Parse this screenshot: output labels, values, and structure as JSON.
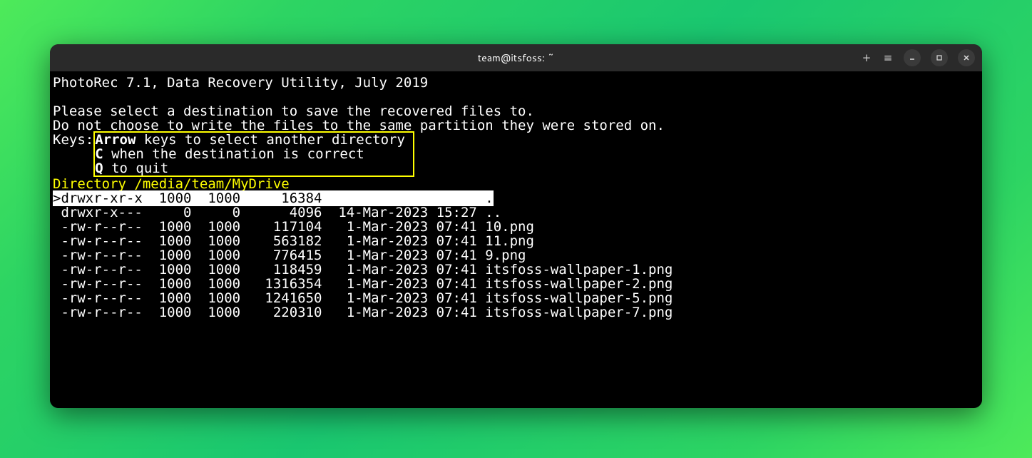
{
  "window": {
    "title": "team@itsfoss: ~"
  },
  "app": {
    "header": "PhotoRec 7.1, Data Recovery Utility, July 2019",
    "prompt1": "Please select a destination to save the recovered files to.",
    "prompt2": "Do not choose to write the files to the same partition they were stored on.",
    "keys_label": "Keys:",
    "keys": {
      "arrow_key": "Arrow",
      "arrow_desc": " keys to select another directory",
      "c_key": "C",
      "c_desc": " when the destination is correct",
      "q_key": "Q",
      "q_desc": " to quit"
    },
    "directory_label": "Directory ",
    "directory_path": "/media/team/MyDrive"
  },
  "files": [
    {
      "perm": ">drwxr-xr-x",
      "uid": " 1000",
      "gid": " 1000",
      "size": "    16384",
      "date": "                  ",
      "name": ".",
      "selected": true
    },
    {
      "perm": " drwxr-x---",
      "uid": "    0",
      "gid": "    0",
      "size": "     4096",
      "date": " 14-Mar-2023 15:27",
      "name": ".."
    },
    {
      "perm": " -rw-r--r--",
      "uid": " 1000",
      "gid": " 1000",
      "size": "   117104",
      "date": "  1-Mar-2023 07:41",
      "name": "10.png"
    },
    {
      "perm": " -rw-r--r--",
      "uid": " 1000",
      "gid": " 1000",
      "size": "   563182",
      "date": "  1-Mar-2023 07:41",
      "name": "11.png"
    },
    {
      "perm": " -rw-r--r--",
      "uid": " 1000",
      "gid": " 1000",
      "size": "   776415",
      "date": "  1-Mar-2023 07:41",
      "name": "9.png"
    },
    {
      "perm": " -rw-r--r--",
      "uid": " 1000",
      "gid": " 1000",
      "size": "   118459",
      "date": "  1-Mar-2023 07:41",
      "name": "itsfoss-wallpaper-1.png"
    },
    {
      "perm": " -rw-r--r--",
      "uid": " 1000",
      "gid": " 1000",
      "size": "  1316354",
      "date": "  1-Mar-2023 07:41",
      "name": "itsfoss-wallpaper-2.png"
    },
    {
      "perm": " -rw-r--r--",
      "uid": " 1000",
      "gid": " 1000",
      "size": "  1241650",
      "date": "  1-Mar-2023 07:41",
      "name": "itsfoss-wallpaper-5.png"
    },
    {
      "perm": " -rw-r--r--",
      "uid": " 1000",
      "gid": " 1000",
      "size": "   220310",
      "date": "  1-Mar-2023 07:41",
      "name": "itsfoss-wallpaper-7.png"
    }
  ]
}
